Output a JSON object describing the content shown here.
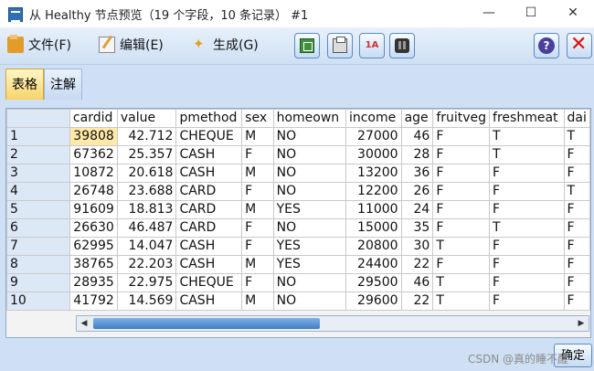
{
  "window": {
    "title": "从 Healthy 节点预览（19 个字段，10 条记录） #1",
    "controls": {
      "minimize": "—",
      "maximize": "☐",
      "close": "✕"
    }
  },
  "menu": {
    "file": "文件(F)",
    "edit": "编辑(E)",
    "generate": "生成(G)"
  },
  "toolbar": {
    "sort_icon_label": "1A",
    "help_label": "?",
    "close_label": "✕"
  },
  "tabs": {
    "table": "表格",
    "notes": "注解"
  },
  "grid": {
    "columns": [
      "cardid",
      "value",
      "pmethod",
      "sex",
      "homeown",
      "income",
      "age",
      "fruitveg",
      "freshmeat",
      "dai"
    ],
    "rows": [
      [
        "1",
        "39808",
        "42.712",
        "CHEQUE",
        "M",
        "NO",
        "27000",
        "46",
        "F",
        "T",
        "T"
      ],
      [
        "2",
        "67362",
        "25.357",
        "CASH",
        "F",
        "NO",
        "30000",
        "28",
        "F",
        "T",
        "F"
      ],
      [
        "3",
        "10872",
        "20.618",
        "CASH",
        "M",
        "NO",
        "13200",
        "36",
        "F",
        "F",
        "F"
      ],
      [
        "4",
        "26748",
        "23.688",
        "CARD",
        "F",
        "NO",
        "12200",
        "26",
        "F",
        "F",
        "T"
      ],
      [
        "5",
        "91609",
        "18.813",
        "CARD",
        "M",
        "YES",
        "11000",
        "24",
        "F",
        "F",
        "F"
      ],
      [
        "6",
        "26630",
        "46.487",
        "CARD",
        "F",
        "NO",
        "15000",
        "35",
        "F",
        "T",
        "F"
      ],
      [
        "7",
        "62995",
        "14.047",
        "CASH",
        "F",
        "YES",
        "20800",
        "30",
        "T",
        "F",
        "F"
      ],
      [
        "8",
        "38765",
        "22.203",
        "CASH",
        "M",
        "YES",
        "24400",
        "22",
        "F",
        "F",
        "F"
      ],
      [
        "9",
        "28935",
        "22.975",
        "CHEQUE",
        "F",
        "NO",
        "29500",
        "46",
        "T",
        "F",
        "F"
      ],
      [
        "10",
        "41792",
        "14.569",
        "CASH",
        "M",
        "NO",
        "29600",
        "22",
        "T",
        "F",
        "F"
      ]
    ],
    "selected_cell": "39808"
  },
  "footer": {
    "ok_label": "确定",
    "watermark": "CSDN @真的睡不醒"
  },
  "colors": {
    "accent": "#cfe0f4",
    "selected_cell": "#ffe9a8",
    "tab_active": "#f7d36a"
  }
}
